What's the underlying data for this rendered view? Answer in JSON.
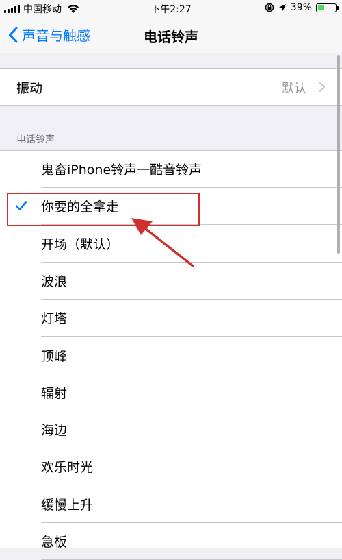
{
  "status_bar": {
    "carrier": "中国移动",
    "time": "下午2:27",
    "battery_percent": "39%",
    "battery_level": 0.39
  },
  "nav": {
    "back_label": "声音与触感",
    "title": "电话铃声"
  },
  "vibration": {
    "label": "振动",
    "value": "默认"
  },
  "ringtones": {
    "section_header": "电话铃声",
    "items": [
      {
        "label": "鬼畜iPhone铃声一酷音铃声",
        "selected": false
      },
      {
        "label": "你要的全拿走",
        "selected": true
      },
      {
        "label": "开场（默认）",
        "selected": false
      },
      {
        "label": "波浪",
        "selected": false
      },
      {
        "label": "灯塔",
        "selected": false
      },
      {
        "label": "顶峰",
        "selected": false
      },
      {
        "label": "辐射",
        "selected": false
      },
      {
        "label": "海边",
        "selected": false
      },
      {
        "label": "欢乐时光",
        "selected": false
      },
      {
        "label": "缓慢上升",
        "selected": false
      },
      {
        "label": "急板",
        "selected": false
      }
    ]
  },
  "colors": {
    "accent": "#007aff",
    "annotation": "#d0312d",
    "battery": "#4cd964"
  }
}
